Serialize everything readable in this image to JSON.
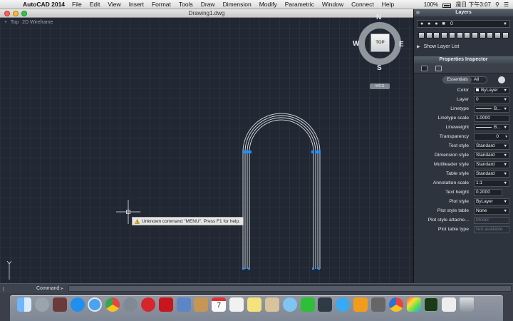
{
  "menubar": {
    "apple_icon": "apple-logo-icon",
    "app_name": "AutoCAD 2014",
    "items": [
      "File",
      "Edit",
      "View",
      "Insert",
      "Format",
      "Tools",
      "Draw",
      "Dimension",
      "Modify",
      "Parametric",
      "Window",
      "Connect",
      "Help"
    ],
    "battery": "100%",
    "clock": "週日 下午3:07"
  },
  "document": {
    "title": "Drawing1.dwg",
    "viewport_labels": [
      "+",
      "Top",
      "2D Wireframe"
    ]
  },
  "viewcube": {
    "north": "N",
    "south": "S",
    "east": "E",
    "west": "W",
    "face": "TOP",
    "wcs": "WCS"
  },
  "tooltip": {
    "text": "Unknown command \"MENU\".  Press F1 for help."
  },
  "command": {
    "label": "Command:",
    "value": ""
  },
  "layers": {
    "title": "Layers",
    "current_layer": "0",
    "show_list": "Show Layer List",
    "tool_count": 12
  },
  "properties": {
    "title": "Properties Inspector",
    "tabs": [
      "Essentials",
      "All"
    ],
    "rows": [
      {
        "label": "Color",
        "value": "ByLayer",
        "type": "color"
      },
      {
        "label": "Layer",
        "value": "0",
        "type": "select"
      },
      {
        "label": "Linetype",
        "value": "B...",
        "type": "linetype"
      },
      {
        "label": "Linetype scale",
        "value": "1.0000",
        "type": "input"
      },
      {
        "label": "Lineweight",
        "value": "B...",
        "type": "linetype"
      },
      {
        "label": "Transparency",
        "value": "0",
        "type": "transparency"
      },
      {
        "label": "Text style",
        "value": "Standard",
        "type": "select"
      },
      {
        "label": "Dimension style",
        "value": "Standard",
        "type": "select"
      },
      {
        "label": "Multileader style",
        "value": "Standard",
        "type": "select"
      },
      {
        "label": "Table style",
        "value": "Standard",
        "type": "select"
      },
      {
        "label": "Annotation scale",
        "value": "1:1",
        "type": "select"
      },
      {
        "label": "Text height",
        "value": "0.2000",
        "type": "input"
      },
      {
        "label": "Plot style",
        "value": "ByLayer",
        "type": "select"
      },
      {
        "label": "Plot style table",
        "value": "None",
        "type": "select"
      },
      {
        "label": "Plot style attache...",
        "value": "Model",
        "type": "disabled"
      },
      {
        "label": "Plot table type",
        "value": "Not available",
        "type": "disabled"
      }
    ]
  },
  "dock": {
    "apps": [
      "finder-icon",
      "launchpad-icon",
      "photo-booth-icon",
      "app-store-icon",
      "safari-icon",
      "chrome-icon",
      "compass-app-icon",
      "opera-icon",
      "autocad-icon",
      "preview-icon",
      "contacts-icon",
      "calendar-icon",
      "textedit-icon",
      "stickies-icon",
      "mail-photo-icon",
      "messages-icon",
      "line-icon",
      "camera-icon",
      "itunes-icon",
      "ibooks-icon",
      "photo-app-icon",
      "chrome-canary-icon",
      "color-app-icon",
      "terminal-icon",
      "downloads-stack-icon",
      "trash-icon"
    ],
    "calendar_day": "7"
  },
  "colors": {
    "viewport_bg": "#212833",
    "geometry": "#d8dde2",
    "grip": "#1e90ff",
    "panel_bg": "#2e343d"
  }
}
